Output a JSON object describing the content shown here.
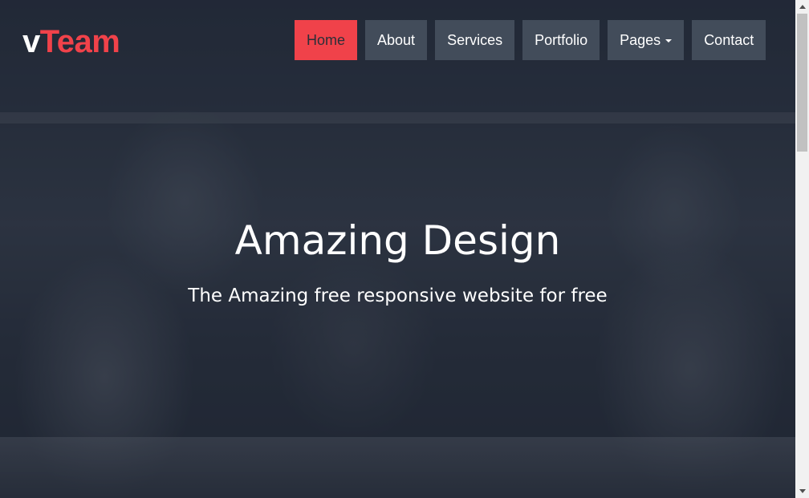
{
  "header": {
    "logo": {
      "part1": "v",
      "part2": "Team"
    },
    "nav": [
      {
        "label": "Home",
        "active": true
      },
      {
        "label": "About",
        "active": false
      },
      {
        "label": "Services",
        "active": false
      },
      {
        "label": "Portfolio",
        "active": false
      },
      {
        "label": "Pages",
        "active": false,
        "dropdown": true
      },
      {
        "label": "Contact",
        "active": false
      }
    ]
  },
  "hero": {
    "title": "Amazing Design",
    "subtitle": "The Amazing free responsive website for free"
  },
  "colors": {
    "accent": "#f0424a",
    "nav_bg": "#485260",
    "text": "#ffffff"
  },
  "icons": {
    "dropdown": "caret-down-icon",
    "scroll_up": "scroll-up-arrow-icon",
    "scroll_down": "scroll-down-arrow-icon"
  }
}
